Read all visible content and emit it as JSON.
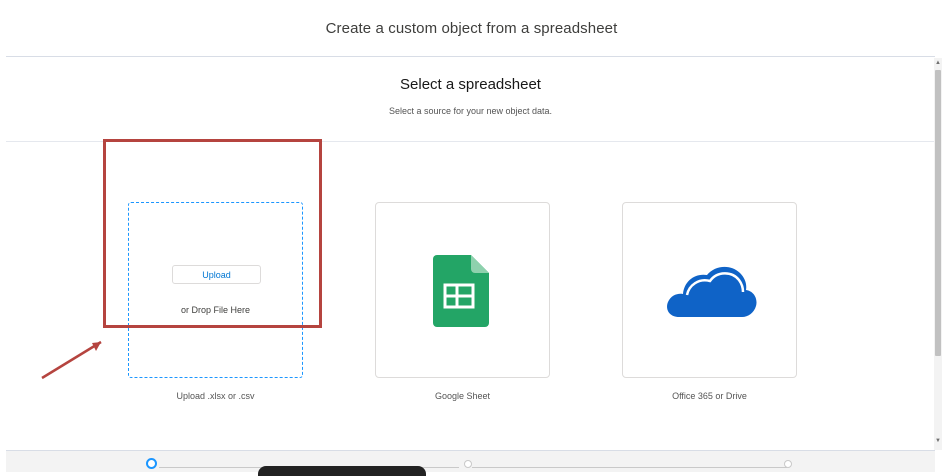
{
  "page": {
    "title": "Create a custom object from a spreadsheet"
  },
  "section": {
    "heading": "Select a spreadsheet",
    "subheading": "Select a source for your new object data."
  },
  "sources": {
    "upload": {
      "button_label": "Upload",
      "drop_text": "or Drop File Here",
      "label": "Upload .xlsx or .csv"
    },
    "google": {
      "label": "Google Sheet"
    },
    "office": {
      "label": "Office 365 or Drive"
    }
  },
  "colors": {
    "accent": "#1b96ff",
    "highlight": "#b5443f",
    "google_green": "#23a566",
    "onedrive_blue": "#0f63c7"
  },
  "progress": {
    "steps": 3,
    "current_step": 1
  },
  "icons": {
    "google": "google-sheets-icon",
    "office": "onedrive-cloud-icon",
    "annotation": "arrow-annotation"
  }
}
